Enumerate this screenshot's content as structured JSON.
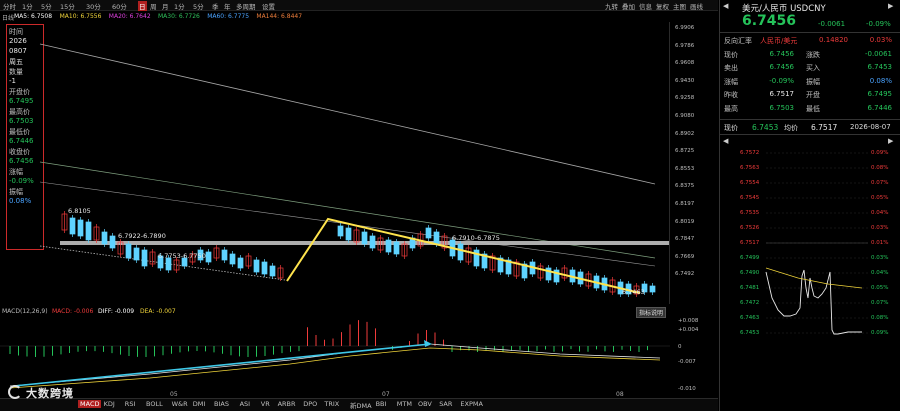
{
  "toolbar": {
    "tabs": [
      "分时",
      "1分",
      "5分",
      "15分",
      "30分",
      "60分",
      "日",
      "周",
      "月",
      "1分",
      "5分",
      "季",
      "年",
      "多周期",
      "设置"
    ],
    "active": "日",
    "right": [
      "九转",
      "叠加",
      "信息",
      "复权",
      "主图",
      "画线"
    ]
  },
  "ma_line": {
    "label": "日线",
    "items": [
      {
        "text": "MA5: 6.7508",
        "color": "#ffffff"
      },
      {
        "text": "MA10: 6.7556",
        "color": "#f0d43a"
      },
      {
        "text": "MA20: 6.7642",
        "color": "#e040e0"
      },
      {
        "text": "MA30: 6.7726",
        "color": "#2fc25b"
      },
      {
        "text": "MA60: 6.7775",
        "color": "#4aa3ff"
      },
      {
        "text": "MA144: 6.8447",
        "color": "#f07f3c"
      }
    ]
  },
  "info_panel": {
    "items": [
      {
        "k": "时间",
        "v": "2026"
      },
      {
        "k": "",
        "v": "0807"
      },
      {
        "k": "",
        "v": "周五"
      },
      {
        "k": "数量",
        "v": "-1"
      },
      {
        "k": "开盘价",
        "v": "6.7495"
      },
      {
        "k": "最高价",
        "v": "6.7503"
      },
      {
        "k": "最低价",
        "v": "6.7446"
      },
      {
        "k": "收盘价",
        "v": "6.7456"
      },
      {
        "k": "涨幅",
        "v": "-0.09%"
      },
      {
        "k": "振幅",
        "v": "0.08%"
      }
    ]
  },
  "price_axis": [
    "6.9906",
    "6.9786",
    "6.9608",
    "6.9430",
    "6.9258",
    "6.9080",
    "6.8902",
    "6.8725",
    "6.8553",
    "6.8375",
    "6.8197",
    "6.8019",
    "6.7847",
    "6.7669",
    "6.7492"
  ],
  "annotations": [
    {
      "text": "6.8105"
    },
    {
      "text": "6.7922-6.7890"
    },
    {
      "text": "6.7753-6.7750"
    },
    {
      "text": "6.7910-6.7875"
    },
    {
      "text": "6.7463"
    }
  ],
  "macd": {
    "label": "MACD(12,26,9)",
    "macd": "MACD: -0.006",
    "diff": "DIFF: -0.009",
    "dea": "DEA: -0.007",
    "guide_btn": "指标说明",
    "axis": [
      "+0.008",
      "+0.004",
      "0",
      "-0.007",
      "-0.010"
    ]
  },
  "date_axis": [
    "05",
    "07",
    "08"
  ],
  "indicator_tabs": [
    "MACD",
    "KDJ",
    "RSI",
    "BOLL",
    "W&R",
    "DMI",
    "BIAS",
    "ASI",
    "VR",
    "ARBR",
    "DPO",
    "TRIX",
    "新DMA",
    "BBI",
    "MTM",
    "OBV",
    "SAR",
    "EXPMA"
  ],
  "active_indicator": "MACD",
  "watermark": "大数跨境",
  "right_panel": {
    "title": "美元/人民币 USDCNY",
    "price": "6.7456",
    "change": "-0.0061",
    "change_pct": "-0.09%",
    "rows": [
      {
        "k": "反向汇率",
        "v": "人民币/美元",
        "v2": "0.14820",
        "v3": "0.03%"
      },
      {
        "k": "现价",
        "v": "6.7456",
        "k2": "涨跌",
        "v2": "-0.0061"
      },
      {
        "k": "卖出",
        "v": "6.7456",
        "k2": "买入",
        "v2": "6.7453"
      },
      {
        "k": "涨幅",
        "v": "-0.09%",
        "k2": "振幅",
        "v2": "0.08%"
      },
      {
        "k": "昨收",
        "v": "6.7517",
        "k2": "开盘",
        "v2": "6.7495"
      },
      {
        "k": "最高",
        "v": "6.7503",
        "k2": "最低",
        "v2": "6.7446"
      }
    ],
    "bottom_line": {
      "k1": "现价",
      "v1": "6.7453",
      "k2": "均价",
      "v2": "6.7517",
      "date": "2026-08-07"
    },
    "mini_left": [
      "6.7572",
      "6.7563",
      "6.7554",
      "6.7545",
      "6.7535",
      "6.7526",
      "6.7517",
      "6.7499",
      "6.7490",
      "6.7481",
      "6.7472",
      "6.7463",
      "6.7453"
    ],
    "mini_right": [
      "0.09%",
      "0.08%",
      "0.07%",
      "0.05%",
      "0.04%",
      "0.03%",
      "0.01%",
      "0.03%",
      "0.04%",
      "0.05%",
      "0.07%",
      "0.08%",
      "0.09%"
    ]
  },
  "colors": {
    "up": "#ef3b3b",
    "down": "#25c35a",
    "candle_blue": "#5fd3ff",
    "trend": "#ffe44d",
    "accent": "#3aa0ff"
  }
}
